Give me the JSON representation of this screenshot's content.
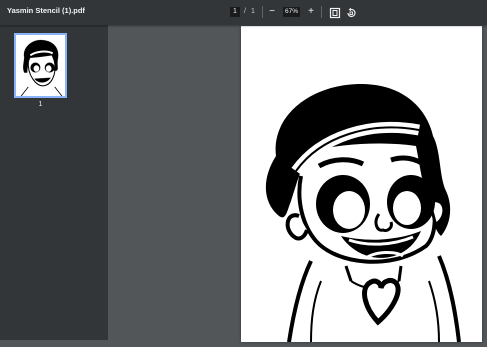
{
  "toolbar": {
    "file_title": "Yasmin Stencil (1).pdf",
    "current_page": "1",
    "page_separator": "/",
    "total_pages": "1",
    "zoom_out_symbol": "−",
    "zoom_level": "67%",
    "zoom_in_symbol": "+",
    "icons": [
      "fit-to-page-icon",
      "rotate-counterclockwise-icon"
    ]
  },
  "sidebar": {
    "thumbnails": [
      {
        "label": "1",
        "selected": true
      }
    ]
  },
  "colors": {
    "toolbar_bg": "#323639",
    "viewer_bg": "#525659",
    "thumb_highlight": "#8ab4f8"
  }
}
